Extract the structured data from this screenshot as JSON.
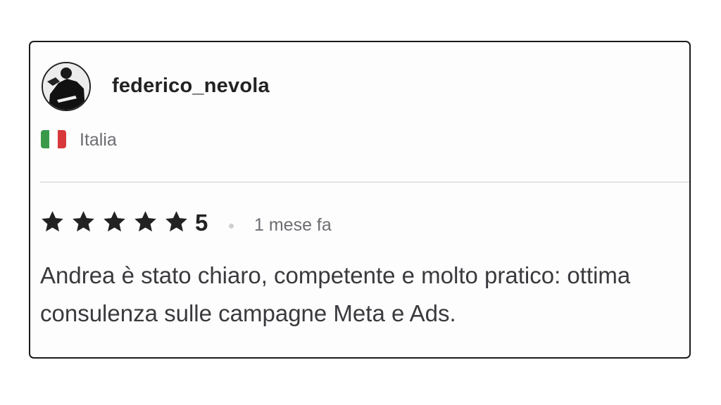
{
  "review": {
    "username": "federico_nevola",
    "country": "Italia",
    "flag_colors": [
      "#3a9a4a",
      "#ffffff",
      "#d9383b"
    ],
    "rating_stars": 5,
    "rating_value": "5",
    "time_ago": "1 mese fa",
    "text": "Andrea è stato chiaro, competente e molto pratico: ottima consulenza sulle campagne Meta e Ads."
  },
  "colors": {
    "text_primary": "#222222",
    "text_secondary": "#6d6d72",
    "border": "#1b1b1b",
    "divider": "#e3e3e6"
  },
  "icons": [
    "avatar-photo",
    "italy-flag-icon",
    "star-icon"
  ]
}
